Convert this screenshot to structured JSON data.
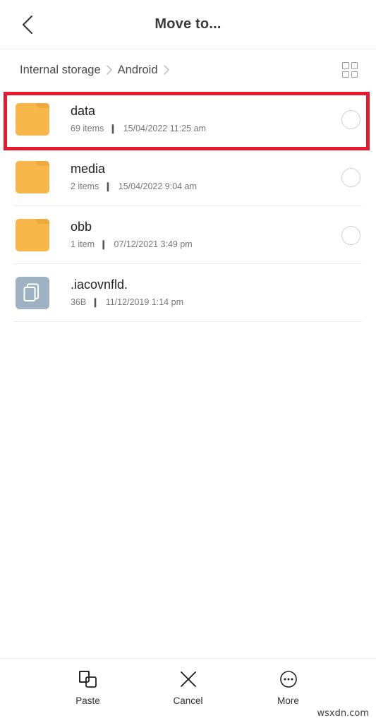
{
  "header": {
    "title": "Move to...",
    "back_icon": "chevron-left-icon"
  },
  "breadcrumb": {
    "items": [
      {
        "label": "Internal storage"
      },
      {
        "label": "Android"
      }
    ],
    "separator_icon": "chevron-right-icon",
    "view_toggle_icon": "grid-view-icon"
  },
  "files": [
    {
      "name": "data",
      "meta_count": "69 items",
      "meta_date": "15/04/2022 11:25 am",
      "type": "folder",
      "icon": "folder-icon",
      "selectable": true,
      "selected": false,
      "highlighted": true
    },
    {
      "name": "media",
      "meta_count": "2 items",
      "meta_date": "15/04/2022 9:04 am",
      "type": "folder",
      "icon": "folder-icon",
      "selectable": true,
      "selected": false,
      "highlighted": false
    },
    {
      "name": "obb",
      "meta_count": "1 item",
      "meta_date": "07/12/2021 3:49 pm",
      "type": "folder",
      "icon": "folder-icon",
      "selectable": true,
      "selected": false,
      "highlighted": false
    },
    {
      "name": ".iacovnfld.",
      "meta_count": "36B",
      "meta_date": "11/12/2019 1:14 pm",
      "type": "file",
      "icon": "document-icon",
      "selectable": false,
      "selected": false,
      "highlighted": false
    }
  ],
  "toolbar": {
    "buttons": [
      {
        "label": "Paste",
        "icon": "paste-icon"
      },
      {
        "label": "Cancel",
        "icon": "close-x-icon"
      },
      {
        "label": "More",
        "icon": "more-ellipsis-icon"
      }
    ]
  },
  "watermark": {
    "text": "wsxdn.com"
  },
  "colors": {
    "folder": "#f7b74b",
    "file": "#9fb2c4",
    "annotation": "#e8192c",
    "text_primary": "#1f1f1f",
    "text_secondary": "#777777"
  }
}
